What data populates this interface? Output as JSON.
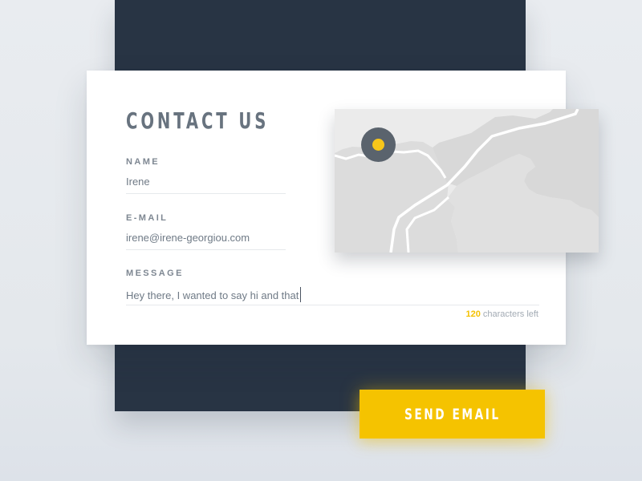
{
  "contact_form": {
    "title": "CONTACT US",
    "name": {
      "label": "NAME",
      "value": "Irene"
    },
    "email": {
      "label": "E-MAIL",
      "value": "irene@irene-georgiou.com"
    },
    "message": {
      "label": "MESSAGE",
      "value": "Hey there, I wanted to say hi and that"
    },
    "counter": {
      "count": "120",
      "suffix": "characters left"
    }
  },
  "map": {
    "marker_icon": "location-pin-icon",
    "colors": {
      "water": "#ebebeb",
      "land": "#dcdcdc",
      "roads": "#ffffff",
      "marker": "#5a636d",
      "marker_dot": "#f7c61a"
    }
  },
  "send_button": {
    "label": "SEND EMAIL"
  },
  "colors": {
    "accent": "#f5c300",
    "backdrop": "#283444",
    "card": "#ffffff",
    "title": "#68737f",
    "label": "#7e8792",
    "value": "#6f7a86"
  }
}
